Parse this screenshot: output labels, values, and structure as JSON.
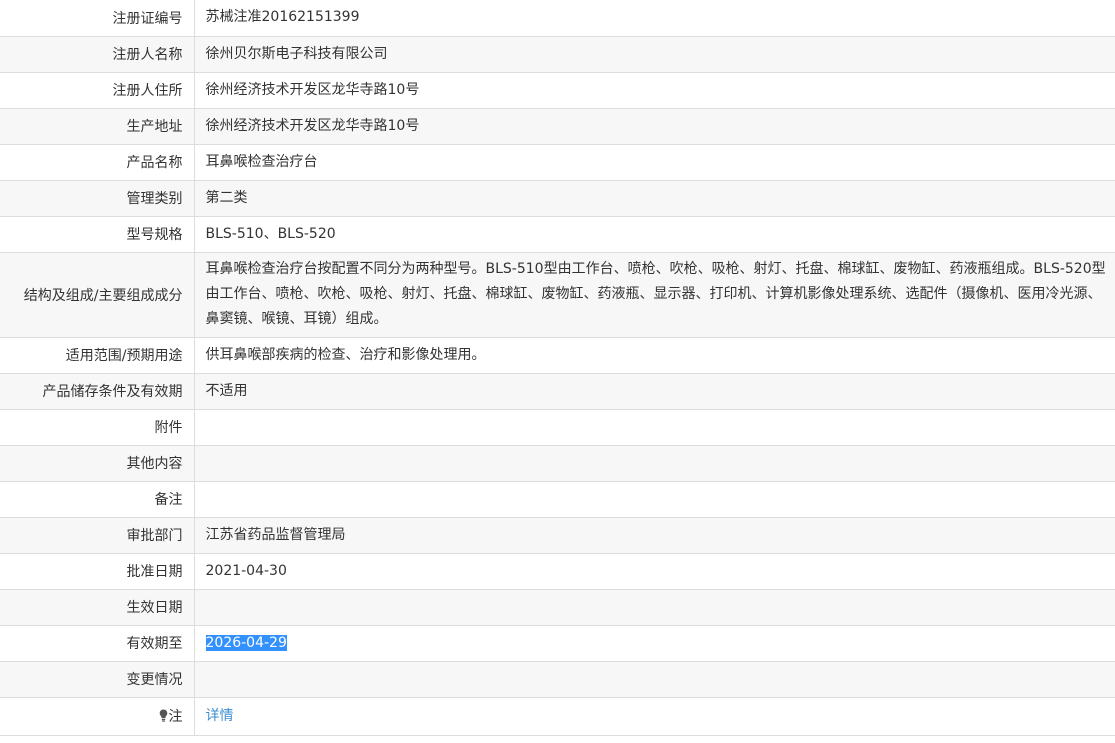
{
  "rows": [
    {
      "label": "注册证编号",
      "value": "苏械注准20162151399"
    },
    {
      "label": "注册人名称",
      "value": "徐州贝尔斯电子科技有限公司"
    },
    {
      "label": "注册人住所",
      "value": "徐州经济技术开发区龙华寺路10号"
    },
    {
      "label": "生产地址",
      "value": "徐州经济技术开发区龙华寺路10号"
    },
    {
      "label": "产品名称",
      "value": "耳鼻喉检查治疗台"
    },
    {
      "label": "管理类别",
      "value": "第二类"
    },
    {
      "label": "型号规格",
      "value": "BLS-510、BLS-520"
    },
    {
      "label": "结构及组成/主要组成成分",
      "value": "耳鼻喉检查治疗台按配置不同分为两种型号。BLS-510型由工作台、喷枪、吹枪、吸枪、射灯、托盘、棉球缸、废物缸、药液瓶组成。BLS-520型由工作台、喷枪、吹枪、吸枪、射灯、托盘、棉球缸、废物缸、药液瓶、显示器、打印机、计算机影像处理系统、选配件（摄像机、医用冷光源、鼻窦镜、喉镜、耳镜）组成。"
    },
    {
      "label": "适用范围/预期用途",
      "value": "供耳鼻喉部疾病的检查、治疗和影像处理用。"
    },
    {
      "label": "产品储存条件及有效期",
      "value": "不适用"
    },
    {
      "label": "附件",
      "value": ""
    },
    {
      "label": "其他内容",
      "value": ""
    },
    {
      "label": "备注",
      "value": ""
    },
    {
      "label": "审批部门",
      "value": "江苏省药品监督管理局"
    },
    {
      "label": "批准日期",
      "value": "2021-04-30"
    },
    {
      "label": "生效日期",
      "value": ""
    },
    {
      "label": "有效期至",
      "value": "2026-04-29"
    },
    {
      "label": "变更情况",
      "value": ""
    }
  ],
  "note": {
    "icon": "lightbulb-icon",
    "label": "注",
    "link_text": "详情"
  },
  "colors": {
    "selection": "#3390ff",
    "link": "#3f8fd2",
    "alt_row": "#f7f7f7",
    "border": "#dddddd"
  }
}
